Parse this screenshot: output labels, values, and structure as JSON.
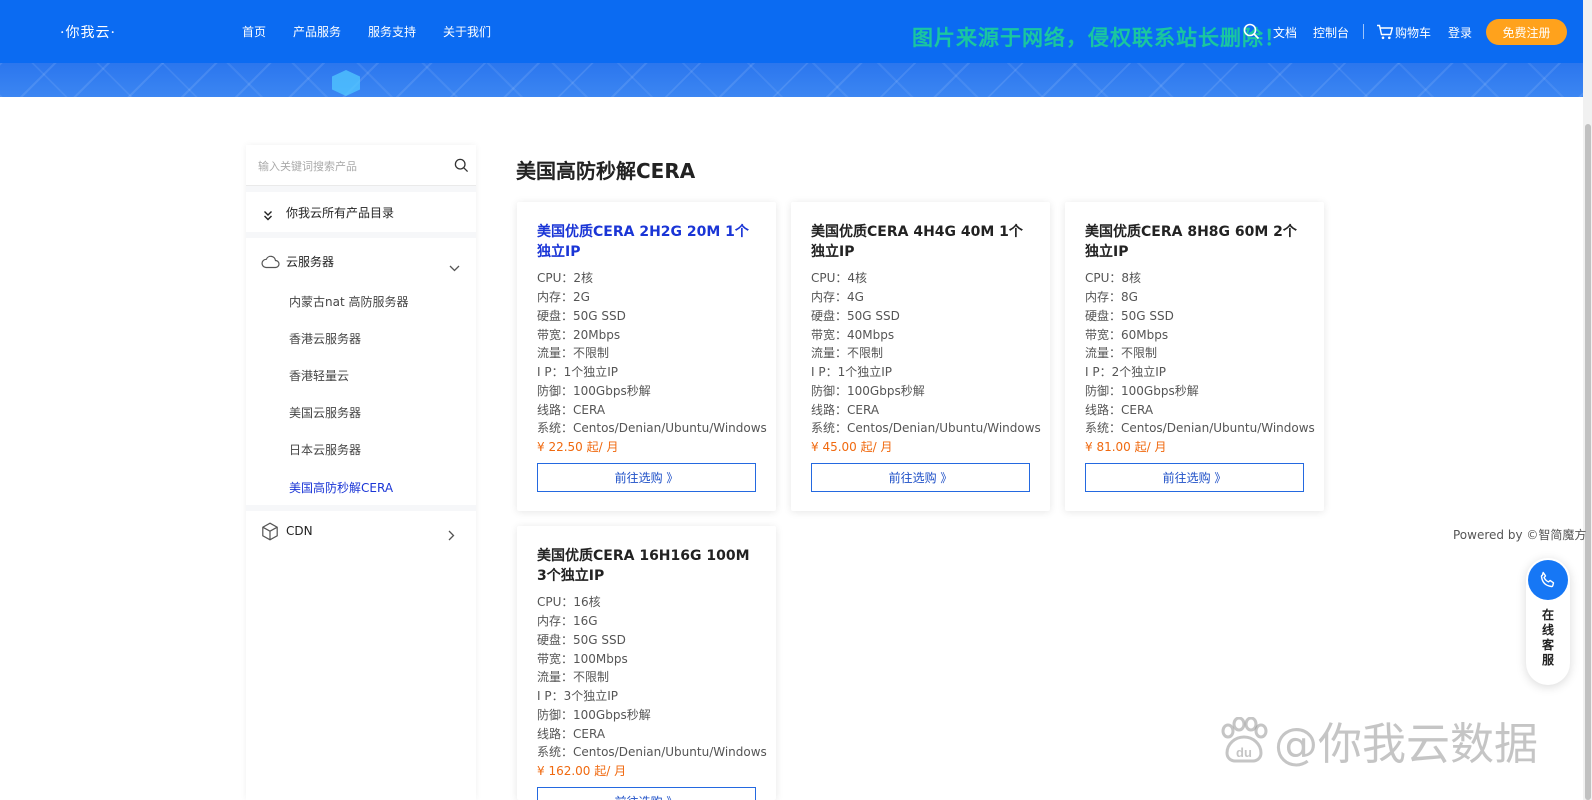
{
  "header": {
    "logo": "·你我云·",
    "nav": [
      "首页",
      "产品服务",
      "服务支持",
      "关于我们"
    ],
    "watermark_notice": "图片来源于网络，侵权联系站长删除！",
    "docs": "文档",
    "console": "控制台",
    "cart": "购物车",
    "login": "登录",
    "register": "免费注册",
    "colors": {
      "primary": "#0b6bf2",
      "register_bg": "#ffa21c"
    }
  },
  "sidebar": {
    "search_placeholder": "输入关键词搜索产品",
    "catalog": "你我云所有产品目录",
    "category_cloud": "云服务器",
    "cloud_items": [
      "内蒙古nat 高防服务器",
      "香港云服务器",
      "香港轻量云",
      "美国云服务器",
      "日本云服务器",
      "美国高防秒解CERA"
    ],
    "active_item": "美国高防秒解CERA",
    "category_cdn": "CDN"
  },
  "main": {
    "title": "美国高防秒解CERA",
    "buy_label": "前往选购 》",
    "cards": [
      {
        "title": "美国优质CERA 2H2G 20M 1个独立IP",
        "specs": [
          "CPU：2核",
          "内存：2G",
          "硬盘：50G SSD",
          "带宽：20Mbps",
          "流量：不限制",
          "I P：1个独立IP",
          "防御：100Gbps秒解",
          "线路：CERA",
          "系统：Centos/Denian/Ubuntu/Windows"
        ],
        "price": "¥ 22.50 起/ 月"
      },
      {
        "title": "美国优质CERA 4H4G 40M 1个独立IP",
        "specs": [
          "CPU：4核",
          "内存：4G",
          "硬盘：50G SSD",
          "带宽：40Mbps",
          "流量：不限制",
          "I P：1个独立IP",
          "防御：100Gbps秒解",
          "线路：CERA",
          "系统：Centos/Denian/Ubuntu/Windows"
        ],
        "price": "¥ 45.00 起/ 月"
      },
      {
        "title": "美国优质CERA 8H8G 60M 2个独立IP",
        "specs": [
          "CPU：8核",
          "内存：8G",
          "硬盘：50G SSD",
          "带宽：60Mbps",
          "流量：不限制",
          "I P：2个独立IP",
          "防御：100Gbps秒解",
          "线路：CERA",
          "系统：Centos/Denian/Ubuntu/Windows"
        ],
        "price": "¥ 81.00 起/ 月"
      },
      {
        "title": "美国优质CERA 16H16G 100M 3个独立IP",
        "specs": [
          "CPU：16核",
          "内存：16G",
          "硬盘：50G SSD",
          "带宽：100Mbps",
          "流量：不限制",
          "I P：3个独立IP",
          "防御：100Gbps秒解",
          "线路：CERA",
          "系统：Centos/Denian/Ubuntu/Windows"
        ],
        "price": "¥ 162.00 起/ 月"
      }
    ],
    "price_color": "#f0690f"
  },
  "footer": {
    "powered": "Powered by ©智简魔方"
  },
  "service": {
    "label": "在线客服"
  },
  "watermark": {
    "text": "@你我云数据"
  }
}
